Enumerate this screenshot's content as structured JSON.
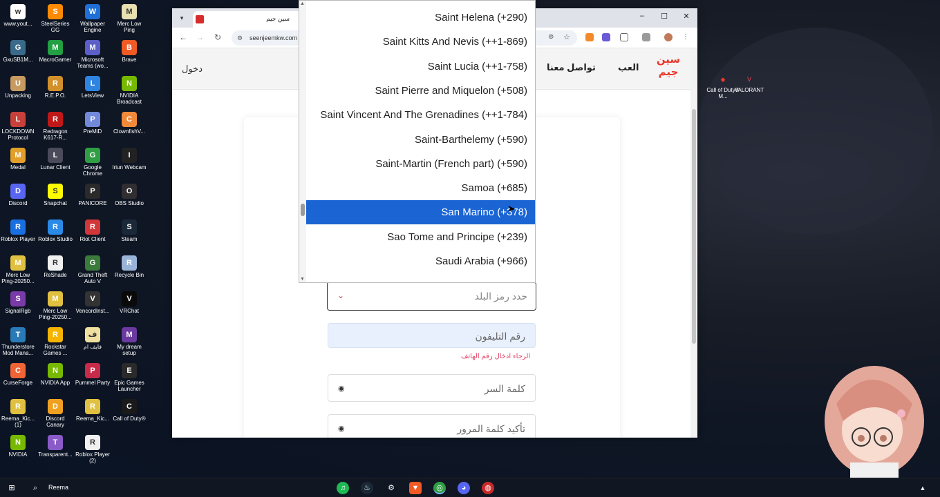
{
  "desktop": {
    "icons": [
      {
        "label": "www.yout...",
        "icon": "youtube-shortcut-icon",
        "color": "#ffffff",
        "col": 0,
        "row": 0
      },
      {
        "label": "SteelSeries GG",
        "icon": "steelseries-icon",
        "color": "#ff8a00",
        "col": 1,
        "row": 0
      },
      {
        "label": "Wallpaper Engine",
        "icon": "wallpaper-engine-icon",
        "color": "#1f6fd6",
        "col": 2,
        "row": 0
      },
      {
        "label": "Merc Low Ping",
        "icon": "file-icon",
        "color": "#e8e0b0",
        "col": 3,
        "row": 0
      },
      {
        "label": "GxuSB1M...",
        "icon": "app-icon",
        "color": "#3a6a8a",
        "col": 0,
        "row": 1
      },
      {
        "label": "MacroGamer",
        "icon": "macrogamer-icon",
        "color": "#22a043",
        "col": 1,
        "row": 1
      },
      {
        "label": "Microsoft Teams (wo...",
        "icon": "teams-icon",
        "color": "#5b5fc7",
        "col": 2,
        "row": 1
      },
      {
        "label": "Brave",
        "icon": "brave-icon",
        "color": "#f05a24",
        "col": 3,
        "row": 1
      },
      {
        "label": "Unpacking",
        "icon": "unpacking-icon",
        "color": "#c79a62",
        "col": 0,
        "row": 2
      },
      {
        "label": "R.E.P.O.",
        "icon": "repo-icon",
        "color": "#d2902a",
        "col": 1,
        "row": 2
      },
      {
        "label": "LetsView",
        "icon": "letsview-icon",
        "color": "#2e84e0",
        "col": 2,
        "row": 2
      },
      {
        "label": "NVIDIA Broadcast",
        "icon": "nvidia-icon",
        "color": "#76b900",
        "col": 3,
        "row": 2
      },
      {
        "label": "LOCKDOWN Protocol",
        "icon": "lockdown-icon",
        "color": "#c8403a",
        "col": 0,
        "row": 3
      },
      {
        "label": "Redragon K617-R...",
        "icon": "redragon-icon",
        "color": "#c01818",
        "col": 1,
        "row": 3
      },
      {
        "label": "PreMiD",
        "icon": "premid-icon",
        "color": "#7289da",
        "col": 2,
        "row": 3
      },
      {
        "label": "ClownfishV...",
        "icon": "clownfish-icon",
        "color": "#f08a3a",
        "col": 3,
        "row": 3
      },
      {
        "label": "Medal",
        "icon": "medal-icon",
        "color": "#e2a02a",
        "col": 0,
        "row": 4
      },
      {
        "label": "Lunar Client",
        "icon": "lunar-client-icon",
        "color": "#4a4a5a",
        "col": 1,
        "row": 4
      },
      {
        "label": "Google Chrome",
        "icon": "chrome-icon",
        "color": "#2f9e44",
        "col": 2,
        "row": 4
      },
      {
        "label": "Iriun Webcam",
        "icon": "iriun-webcam-icon",
        "color": "#222222",
        "col": 3,
        "row": 4
      },
      {
        "label": "Discord",
        "icon": "discord-icon",
        "color": "#5865f2",
        "col": 0,
        "row": 5
      },
      {
        "label": "Snapchat",
        "icon": "snapchat-icon",
        "color": "#fffc00",
        "col": 1,
        "row": 5
      },
      {
        "label": "PANICORE",
        "icon": "panicore-icon",
        "color": "#2a2a2a",
        "col": 2,
        "row": 5
      },
      {
        "label": "OBS Studio",
        "icon": "obs-icon",
        "color": "#302e31",
        "col": 3,
        "row": 5
      },
      {
        "label": "Roblox Player",
        "icon": "roblox-icon",
        "color": "#1a6fe0",
        "col": 0,
        "row": 6
      },
      {
        "label": "Roblox Studio",
        "icon": "roblox-studio-icon",
        "color": "#2a8ae8",
        "col": 1,
        "row": 6
      },
      {
        "label": "Riot Client",
        "icon": "riot-icon",
        "color": "#d13639",
        "col": 2,
        "row": 6
      },
      {
        "label": "Steam",
        "icon": "steam-icon",
        "color": "#1b2838",
        "col": 3,
        "row": 6
      },
      {
        "label": "Merc Low Ping-20250...",
        "icon": "zip-icon",
        "color": "#e0c040",
        "col": 0,
        "row": 7
      },
      {
        "label": "ReShade",
        "icon": "file-icon",
        "color": "#f0f0f0",
        "col": 1,
        "row": 7
      },
      {
        "label": "Grand Theft Auto V",
        "icon": "gta-icon",
        "color": "#3a7a3a",
        "col": 2,
        "row": 7
      },
      {
        "label": "Recycle Bin",
        "icon": "recycle-bin-icon",
        "color": "#9ab4d8",
        "col": 3,
        "row": 7
      },
      {
        "label": "SignalRgb",
        "icon": "signalrgb-icon",
        "color": "#7a3aa8",
        "col": 0,
        "row": 8
      },
      {
        "label": "Merc Low Ping-20250...",
        "icon": "zip-icon",
        "color": "#e0c040",
        "col": 1,
        "row": 8
      },
      {
        "label": "VencordInst...",
        "icon": "vencord-icon",
        "color": "#333333",
        "col": 2,
        "row": 8
      },
      {
        "label": "VRChat",
        "icon": "vrchat-icon",
        "color": "#0a0a0a",
        "col": 3,
        "row": 8
      },
      {
        "label": "Thunderstore Mod Mana...",
        "icon": "thunderstore-icon",
        "color": "#2a7ab8",
        "col": 0,
        "row": 9
      },
      {
        "label": "Rockstar Games ...",
        "icon": "rockstar-icon",
        "color": "#f4b400",
        "col": 1,
        "row": 9
      },
      {
        "label": "فايف ام",
        "icon": "file-icon",
        "color": "#f0e0a0",
        "col": 2,
        "row": 9
      },
      {
        "label": "My dream setup",
        "icon": "mydreamsetup-icon",
        "color": "#6a3aa0",
        "col": 3,
        "row": 9
      },
      {
        "label": "CurseForge",
        "icon": "curseforge-icon",
        "color": "#f16436",
        "col": 0,
        "row": 10
      },
      {
        "label": "NVIDIA App",
        "icon": "nvidia-icon",
        "color": "#76b900",
        "col": 1,
        "row": 10
      },
      {
        "label": "Pummel Party",
        "icon": "pummel-party-icon",
        "color": "#c82a4a",
        "col": 2,
        "row": 10
      },
      {
        "label": "Epic Games Launcher",
        "icon": "epic-games-icon",
        "color": "#2a2a2a",
        "col": 3,
        "row": 10
      },
      {
        "label": "Reema_Kic... (1)",
        "icon": "zip-icon",
        "color": "#e0c040",
        "col": 0,
        "row": 11
      },
      {
        "label": "Discord Canary",
        "icon": "discord-canary-icon",
        "color": "#f0a020",
        "col": 1,
        "row": 11
      },
      {
        "label": "Reema_Kic...",
        "icon": "zip-icon",
        "color": "#e0c040",
        "col": 2,
        "row": 11
      },
      {
        "label": "Call of Duty®",
        "icon": "call-of-duty-icon",
        "color": "#1a1a1a",
        "col": 3,
        "row": 11
      },
      {
        "label": "NVIDIA",
        "icon": "nvidia-icon",
        "color": "#76b900",
        "col": 0,
        "row": 12
      },
      {
        "label": "Transparent...",
        "icon": "transparent-icon",
        "color": "#8a5ac8",
        "col": 1,
        "row": 12
      },
      {
        "label": "Roblox Player (2)",
        "icon": "file-icon",
        "color": "#f0f0f0",
        "col": 2,
        "row": 12
      }
    ],
    "right_icons": [
      {
        "label": "Call of Duty® M...",
        "icon": "call-of-duty-mobile-icon"
      },
      {
        "label": "VALORANT",
        "icon": "valorant-icon"
      }
    ]
  },
  "browser": {
    "tab_title": "سين جيم",
    "url": "seenjeemkw.com",
    "header": {
      "login": "دخول",
      "nav_contact": "تواصل معنا",
      "nav_play": "العب",
      "logo_top": "سين",
      "logo_bottom": "جيم"
    },
    "form": {
      "country_code_placeholder": "حدد رمز البلد",
      "phone_placeholder": "رقم التليفون",
      "phone_error": "الرجاء ادخال رقم الهاتف",
      "password_placeholder": "كلمة السر",
      "confirm_password_placeholder": "تأكيد كلمة المرور"
    }
  },
  "dropdown": {
    "options": [
      {
        "label": "Saint Helena (+290)",
        "selected": false
      },
      {
        "label": "Saint Kitts And Nevis (++1-869)",
        "selected": false
      },
      {
        "label": "Saint Lucia (++1-758)",
        "selected": false
      },
      {
        "label": "Saint Pierre and Miquelon (+508)",
        "selected": false
      },
      {
        "label": "Saint Vincent And The Grenadines (++1-784)",
        "selected": false
      },
      {
        "label": "Saint-Barthelemy (+590)",
        "selected": false
      },
      {
        "label": "Saint-Martin (French part) (+590)",
        "selected": false
      },
      {
        "label": "Samoa (+685)",
        "selected": false
      },
      {
        "label": "San Marino (+378)",
        "selected": true
      },
      {
        "label": "Sao Tome and Principe (+239)",
        "selected": false
      },
      {
        "label": "Saudi Arabia (+966)",
        "selected": false
      }
    ],
    "selected_color": "#1a64d4"
  },
  "taskbar": {
    "search_label": "Reema",
    "apps": [
      "spotify-icon",
      "steam-icon",
      "settings-icon",
      "brave-icon",
      "chrome-icon",
      "discord-icon",
      "vpn-icon"
    ]
  }
}
